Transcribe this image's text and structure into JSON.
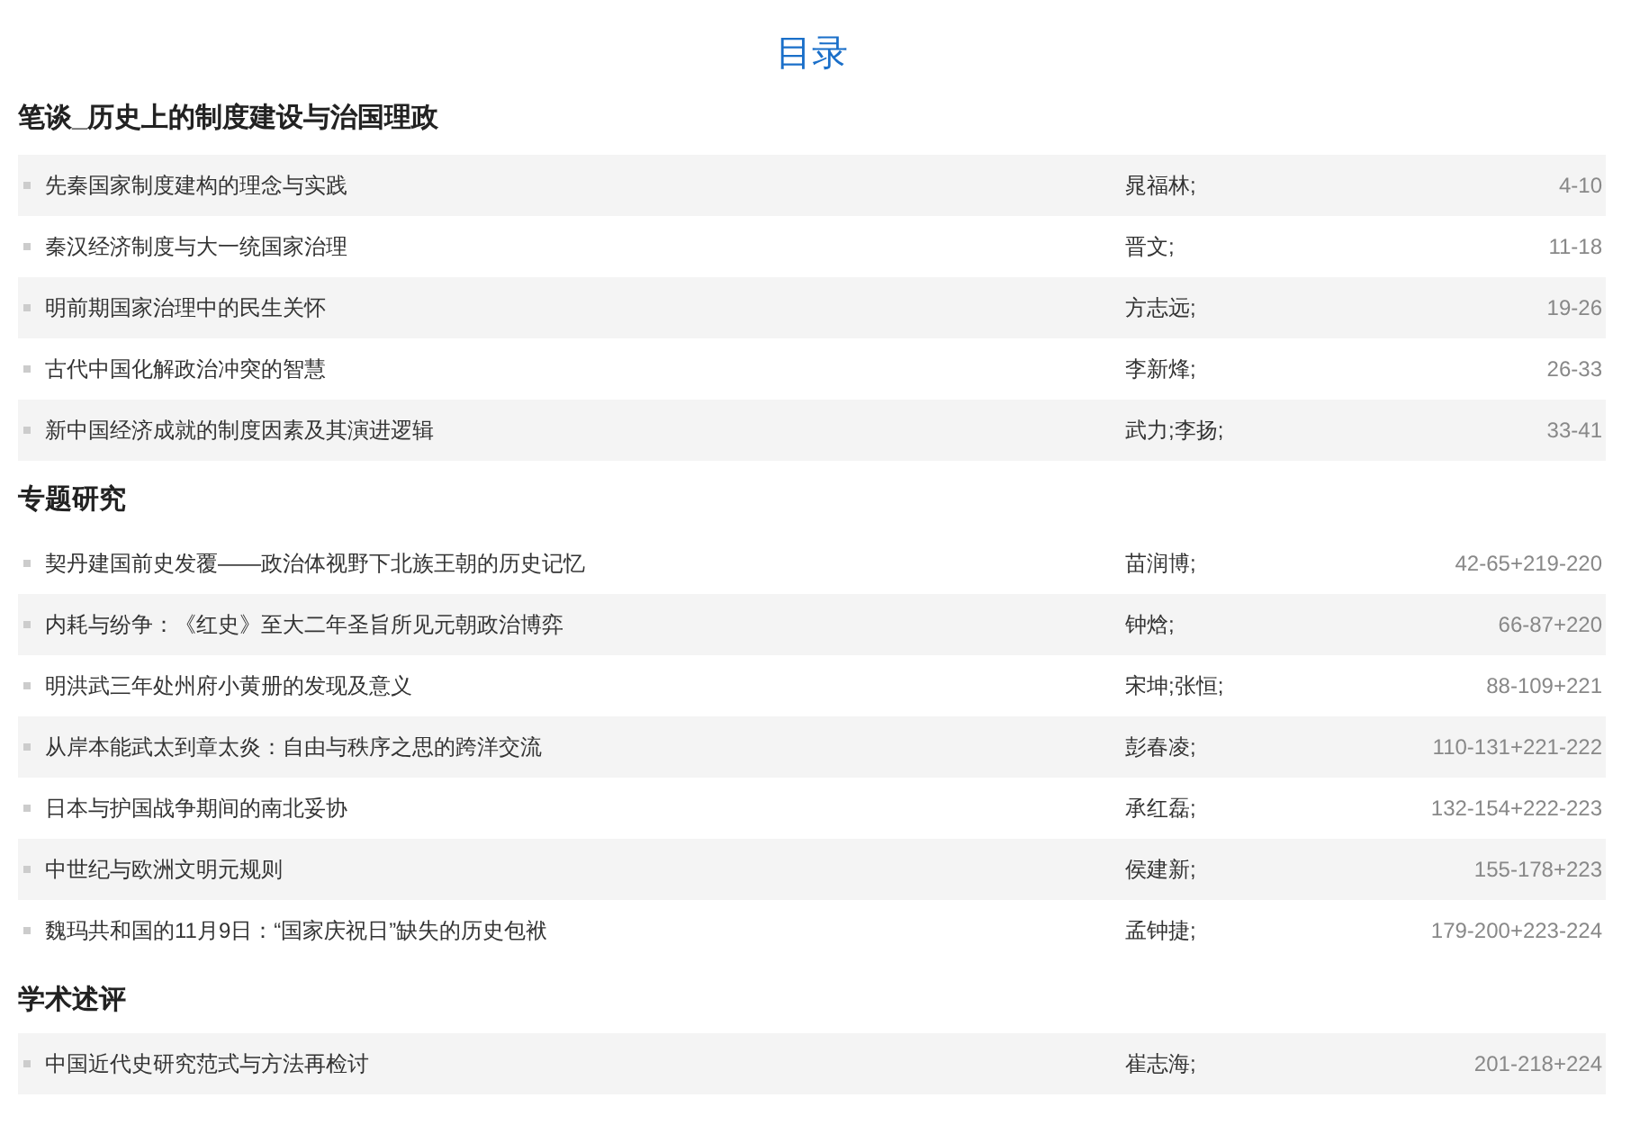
{
  "title": "目录",
  "sections": [
    {
      "heading": "笔谈_历史上的制度建设与治国理政",
      "items": [
        {
          "title": "先秦国家制度建构的理念与实践",
          "authors": "晁福林;",
          "pages": "4-10"
        },
        {
          "title": "秦汉经济制度与大一统国家治理",
          "authors": "晋文;",
          "pages": "11-18"
        },
        {
          "title": "明前期国家治理中的民生关怀",
          "authors": "方志远;",
          "pages": "19-26"
        },
        {
          "title": "古代中国化解政治冲突的智慧",
          "authors": "李新烽;",
          "pages": "26-33"
        },
        {
          "title": "新中国经济成就的制度因素及其演进逻辑",
          "authors": "武力;李扬;",
          "pages": "33-41"
        }
      ]
    },
    {
      "heading": "专题研究",
      "items": [
        {
          "title": "契丹建国前史发覆——政治体视野下北族王朝的历史记忆",
          "authors": "苗润博;",
          "pages": "42-65+219-220"
        },
        {
          "title": "内耗与纷争：《红史》至大二年圣旨所见元朝政治博弈",
          "authors": "钟焓;",
          "pages": "66-87+220"
        },
        {
          "title": "明洪武三年处州府小黄册的发现及意义",
          "authors": "宋坤;张恒;",
          "pages": "88-109+221"
        },
        {
          "title": "从岸本能武太到章太炎：自由与秩序之思的跨洋交流",
          "authors": "彭春凌;",
          "pages": "110-131+221-222"
        },
        {
          "title": "日本与护国战争期间的南北妥协",
          "authors": "承红磊;",
          "pages": "132-154+222-223"
        },
        {
          "title": "中世纪与欧洲文明元规则",
          "authors": "侯建新;",
          "pages": "155-178+223"
        },
        {
          "title": "魏玛共和国的11月9日：“国家庆祝日”缺失的历史包袱",
          "authors": "孟钟捷;",
          "pages": "179-200+223-224"
        }
      ]
    },
    {
      "heading": "学术述评",
      "items": [
        {
          "title": "中国近代史研究范式与方法再检讨",
          "authors": "崔志海;",
          "pages": "201-218+224"
        }
      ]
    }
  ]
}
